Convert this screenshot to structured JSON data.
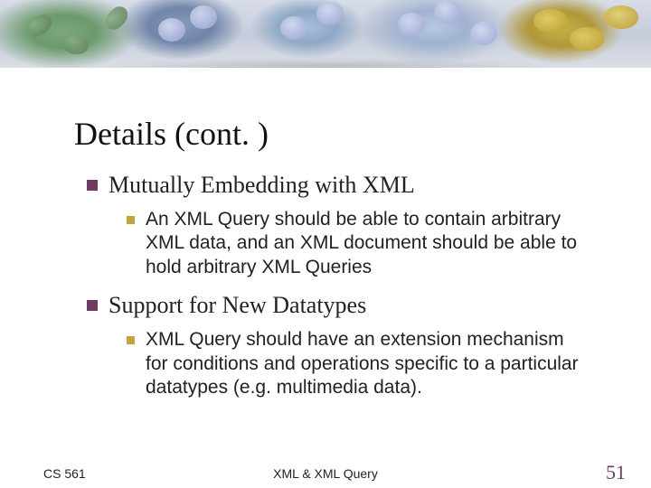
{
  "title": "Details (cont. )",
  "items": [
    {
      "label": "Mutually Embedding with XML",
      "sub": [
        "An XML Query should be able to contain arbitrary XML data, and an XML document should be able to hold arbitrary XML Queries"
      ]
    },
    {
      "label": "Support for New Datatypes",
      "sub": [
        "XML Query should have an extension mechanism for conditions and operations specific to a particular datatypes (e.g. multimedia data)."
      ]
    }
  ],
  "footer": {
    "left": "CS 561",
    "center": "XML & XML Query",
    "page": "51"
  }
}
